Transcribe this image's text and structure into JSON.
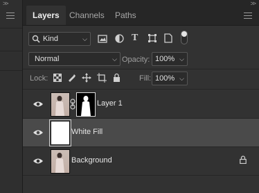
{
  "left_collapse": ">>",
  "right_collapse": ">>",
  "tabs": [
    {
      "label": "Layers",
      "active": true
    },
    {
      "label": "Channels",
      "active": false
    },
    {
      "label": "Paths",
      "active": false
    }
  ],
  "filter": {
    "value": "Kind"
  },
  "blend": {
    "mode": "Normal",
    "opacity_label": "Opacity:",
    "opacity": "100%"
  },
  "lock": {
    "label": "Lock:",
    "fill_label": "Fill:",
    "fill": "100%"
  },
  "layers": [
    {
      "name": "Layer 1",
      "visible": true,
      "selected": false,
      "has_mask": true
    },
    {
      "name": "White Fill",
      "visible": true,
      "selected": true,
      "has_mask": false
    },
    {
      "name": "Background",
      "visible": true,
      "selected": false,
      "locked": true
    }
  ],
  "colors": {
    "panel_bg": "#323232",
    "selected_row": "#4a4a4a",
    "tab_bar": "#262626"
  }
}
